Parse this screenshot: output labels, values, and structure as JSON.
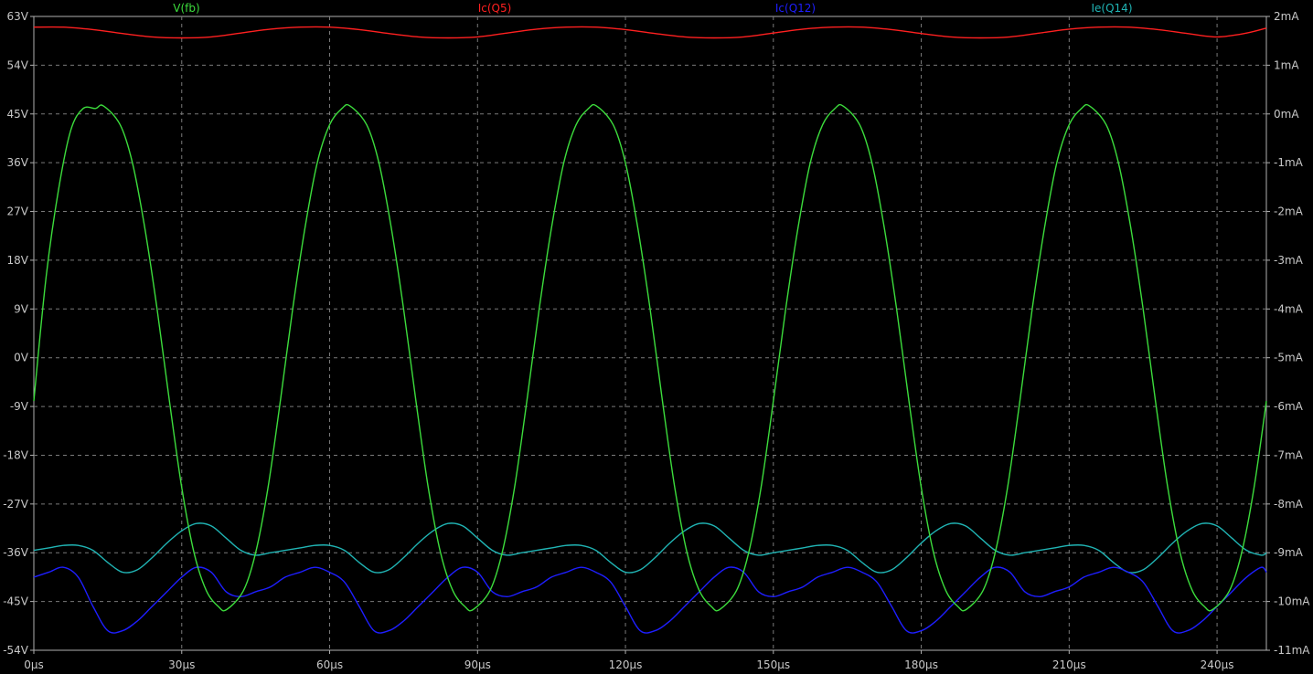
{
  "chart_data": {
    "type": "line",
    "x_unit": "µs",
    "x_range": [
      0,
      250
    ],
    "x_ticks": [
      "0µs",
      "30µs",
      "60µs",
      "90µs",
      "120µs",
      "150µs",
      "180µs",
      "210µs",
      "240µs"
    ],
    "x_tick_values": [
      0,
      30,
      60,
      90,
      120,
      150,
      180,
      210,
      240
    ],
    "left_axis": {
      "range": [
        -54,
        63
      ],
      "ticks": [
        "63V",
        "54V",
        "45V",
        "36V",
        "27V",
        "18V",
        "9V",
        "0V",
        "-9V",
        "-18V",
        "-27V",
        "-36V",
        "-45V",
        "-54V"
      ],
      "tick_values": [
        63,
        54,
        45,
        36,
        27,
        18,
        9,
        0,
        -9,
        -18,
        -27,
        -36,
        -45,
        -54
      ]
    },
    "right_axis": {
      "range": [
        -11,
        2
      ],
      "ticks": [
        "2mA",
        "1mA",
        "0mA",
        "-1mA",
        "-2mA",
        "-3mA",
        "-4mA",
        "-5mA",
        "-6mA",
        "-7mA",
        "-8mA",
        "-9mA",
        "-10mA",
        "-11mA"
      ],
      "tick_values": [
        2,
        1,
        0,
        -1,
        -2,
        -3,
        -4,
        -5,
        -6,
        -7,
        -8,
        -9,
        -10,
        -11
      ]
    },
    "grid": true,
    "legend_position": "top",
    "series": [
      {
        "name": "V(fb)",
        "color": "#3cdc3c",
        "axis": "left",
        "unit": "V",
        "x": [
          0,
          2.5,
          5,
          7.5,
          10,
          12.5,
          14.1,
          17.5,
          20,
          22.5,
          25,
          27.5,
          30,
          32.5,
          35,
          37.5,
          39.1,
          42.5,
          45,
          47.5,
          50,
          52.5,
          55,
          57.5,
          60,
          62.5,
          64.1,
          67.5,
          70,
          72.5,
          75,
          77.5,
          80,
          82.5,
          85,
          87.5,
          89.1,
          92.5,
          95,
          97.5,
          100,
          102.5,
          105,
          107.5,
          110,
          112.5,
          114.1,
          117.5,
          120,
          122.5,
          125,
          127.5,
          130,
          132.5,
          135,
          137.5,
          139.1,
          142.5,
          145,
          147.5,
          150,
          152.5,
          155,
          157.5,
          160,
          162.5,
          164.1,
          167.5,
          170,
          172.5,
          175,
          177.5,
          180,
          182.5,
          185,
          187.5,
          189.1,
          192.5,
          195,
          197.5,
          200,
          202.5,
          205,
          207.5,
          210,
          212.5,
          214.1,
          217.5,
          220,
          222.5,
          225,
          227.5,
          230,
          232.5,
          235,
          237.5,
          239.1,
          242.5,
          245,
          247.5,
          250
        ],
        "y": [
          -8,
          15,
          31,
          42,
          46,
          46,
          46.5,
          43,
          36,
          24,
          9,
          -8,
          -24,
          -36,
          -43,
          -46,
          -46.5,
          -43,
          -36,
          -24,
          -8,
          9,
          24,
          36,
          43,
          46,
          46.5,
          43,
          36,
          24,
          9,
          -8,
          -24,
          -36,
          -43,
          -46,
          -46.5,
          -43,
          -36,
          -24,
          -8,
          9,
          24,
          36,
          43,
          46,
          46.5,
          43,
          36,
          24,
          9,
          -8,
          -24,
          -36,
          -43,
          -46,
          -46.5,
          -43,
          -36,
          -24,
          -8,
          9,
          24,
          36,
          43,
          46,
          46.5,
          43,
          36,
          24,
          9,
          -8,
          -24,
          -36,
          -43,
          -46,
          -46.5,
          -43,
          -36,
          -24,
          -8,
          9,
          24,
          36,
          43,
          46,
          46.5,
          43,
          36,
          24,
          9,
          -8,
          -24,
          -36,
          -43,
          -46,
          -46.5,
          -43,
          -36,
          -24,
          -8
        ]
      },
      {
        "name": "Ic(Q5)",
        "color": "#ff2020",
        "axis": "right",
        "unit": "mA",
        "x": [
          0,
          6,
          12,
          18,
          24,
          30,
          36,
          42,
          48,
          54,
          60,
          66,
          72,
          78,
          84,
          90,
          96,
          102,
          108,
          114,
          120,
          126,
          132,
          138,
          144,
          150,
          156,
          162,
          168,
          174,
          180,
          186,
          192,
          198,
          204,
          210,
          216,
          222,
          228,
          234,
          240,
          246,
          250
        ],
        "y": [
          1.78,
          1.78,
          1.73,
          1.65,
          1.58,
          1.56,
          1.58,
          1.66,
          1.74,
          1.78,
          1.78,
          1.73,
          1.65,
          1.58,
          1.56,
          1.58,
          1.66,
          1.74,
          1.78,
          1.78,
          1.73,
          1.65,
          1.58,
          1.56,
          1.58,
          1.66,
          1.74,
          1.78,
          1.78,
          1.73,
          1.65,
          1.58,
          1.56,
          1.58,
          1.66,
          1.74,
          1.78,
          1.78,
          1.73,
          1.65,
          1.58,
          1.66,
          1.76
        ]
      },
      {
        "name": "Ic(Q12)",
        "color": "#1e1eff",
        "axis": "right",
        "unit": "mA",
        "x": [
          0,
          3,
          6,
          9,
          12,
          15,
          18,
          21,
          24,
          27,
          30,
          33,
          36,
          39,
          42,
          45,
          48,
          51,
          54,
          57,
          60,
          63,
          66,
          69,
          72,
          75,
          78,
          81,
          84,
          87,
          90,
          93,
          96,
          99,
          102,
          105,
          108,
          111,
          114,
          117,
          120,
          123,
          126,
          129,
          132,
          135,
          138,
          141,
          144,
          147,
          150,
          153,
          156,
          159,
          162,
          165,
          168,
          171,
          174,
          177,
          180,
          183,
          186,
          189,
          192,
          195,
          198,
          201,
          204,
          207,
          210,
          213,
          216,
          219,
          222,
          225,
          228,
          231,
          234,
          237,
          240,
          243,
          246,
          249,
          250
        ],
        "y": [
          -9.5,
          -9.4,
          -9.3,
          -9.5,
          -10.1,
          -10.6,
          -10.6,
          -10.4,
          -10.1,
          -9.8,
          -9.5,
          -9.3,
          -9.4,
          -9.8,
          -9.9,
          -9.8,
          -9.7,
          -9.5,
          -9.4,
          -9.3,
          -9.4,
          -9.6,
          -10.1,
          -10.6,
          -10.6,
          -10.4,
          -10.1,
          -9.8,
          -9.5,
          -9.3,
          -9.4,
          -9.8,
          -9.9,
          -9.8,
          -9.7,
          -9.5,
          -9.4,
          -9.3,
          -9.4,
          -9.6,
          -10.1,
          -10.6,
          -10.6,
          -10.4,
          -10.1,
          -9.8,
          -9.5,
          -9.3,
          -9.4,
          -9.8,
          -9.9,
          -9.8,
          -9.7,
          -9.5,
          -9.4,
          -9.3,
          -9.4,
          -9.6,
          -10.1,
          -10.6,
          -10.6,
          -10.4,
          -10.1,
          -9.8,
          -9.5,
          -9.3,
          -9.4,
          -9.8,
          -9.9,
          -9.8,
          -9.7,
          -9.5,
          -9.4,
          -9.3,
          -9.4,
          -9.6,
          -10.1,
          -10.6,
          -10.6,
          -10.4,
          -10.1,
          -9.8,
          -9.5,
          -9.3,
          -9.4
        ]
      },
      {
        "name": "Ie(Q14)",
        "color": "#20b4b4",
        "axis": "right",
        "unit": "mA",
        "x": [
          0,
          3,
          6,
          9,
          12,
          15,
          18,
          21,
          24,
          27,
          30,
          33,
          36,
          39,
          42,
          45,
          48,
          51,
          54,
          57,
          60,
          63,
          66,
          69,
          72,
          75,
          78,
          81,
          84,
          87,
          90,
          93,
          96,
          99,
          102,
          105,
          108,
          111,
          114,
          117,
          120,
          123,
          126,
          129,
          132,
          135,
          138,
          141,
          144,
          147,
          150,
          153,
          156,
          159,
          162,
          165,
          168,
          171,
          174,
          177,
          180,
          183,
          186,
          189,
          192,
          195,
          198,
          201,
          204,
          207,
          210,
          213,
          216,
          219,
          222,
          225,
          228,
          231,
          234,
          237,
          240,
          243,
          246,
          249,
          250
        ],
        "y": [
          -8.95,
          -8.9,
          -8.85,
          -8.85,
          -8.95,
          -9.2,
          -9.4,
          -9.35,
          -9.1,
          -8.8,
          -8.55,
          -8.4,
          -8.45,
          -8.7,
          -8.95,
          -9.05,
          -9.0,
          -8.95,
          -8.9,
          -8.85,
          -8.85,
          -8.95,
          -9.2,
          -9.4,
          -9.35,
          -9.1,
          -8.8,
          -8.55,
          -8.4,
          -8.45,
          -8.7,
          -8.95,
          -9.05,
          -9.0,
          -8.95,
          -8.9,
          -8.85,
          -8.85,
          -8.95,
          -9.2,
          -9.4,
          -9.35,
          -9.1,
          -8.8,
          -8.55,
          -8.4,
          -8.45,
          -8.7,
          -8.95,
          -9.05,
          -9.0,
          -8.95,
          -8.9,
          -8.85,
          -8.85,
          -8.95,
          -9.2,
          -9.4,
          -9.35,
          -9.1,
          -8.8,
          -8.55,
          -8.4,
          -8.45,
          -8.7,
          -8.95,
          -9.05,
          -9.0,
          -8.95,
          -8.9,
          -8.85,
          -8.85,
          -8.95,
          -9.2,
          -9.4,
          -9.35,
          -9.1,
          -8.8,
          -8.55,
          -8.4,
          -8.45,
          -8.7,
          -8.95,
          -9.05,
          -9.0
        ]
      }
    ]
  }
}
